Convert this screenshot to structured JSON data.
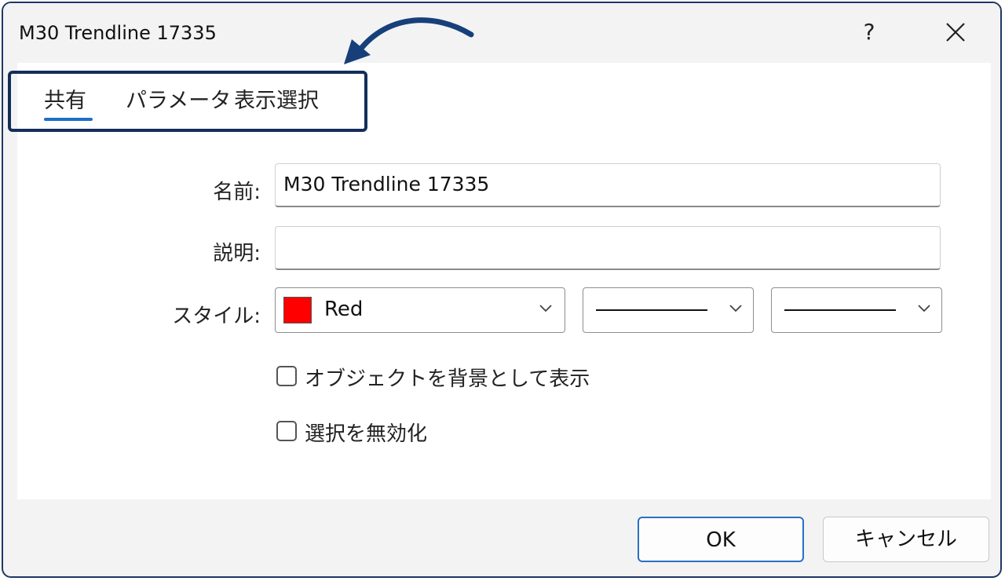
{
  "window": {
    "title": "M30 Trendline 17335",
    "help_label": "?"
  },
  "tabs": [
    {
      "label": "共有",
      "active": true
    },
    {
      "label": "パラメータ",
      "active": false
    },
    {
      "label": "表示選択",
      "active": false
    }
  ],
  "form": {
    "name_label": "名前:",
    "name_value": "M30 Trendline 17335",
    "description_label": "説明:",
    "description_value": "",
    "style_label": "スタイル:",
    "color_value": "Red",
    "color_hex": "#ff0000"
  },
  "checkboxes": [
    {
      "label": "オブジェクトを背景として表示",
      "checked": false
    },
    {
      "label": "選択を無効化",
      "checked": false
    }
  ],
  "buttons": {
    "ok": "OK",
    "cancel": "キャンセル"
  },
  "colors": {
    "accent": "#1e6fc8",
    "highlight_border": "#142e5a",
    "arrow": "#173f7a"
  }
}
